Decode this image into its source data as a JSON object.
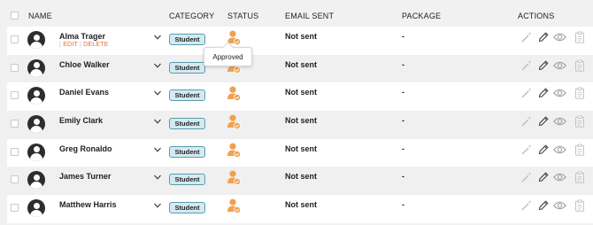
{
  "header": {
    "name": "NAME",
    "category": "CATEGORY",
    "status": "STATUS",
    "email_sent": "EMAIL SENT",
    "package": "PACKAGE",
    "actions": "ACTIONS"
  },
  "row_actions": {
    "edit": "EDIT",
    "delete": "DELETE",
    "separator": "|"
  },
  "tooltip": "Approved",
  "rows": [
    {
      "name": "Alma Trager",
      "category": "Student",
      "email_sent": "Not sent",
      "package": "-"
    },
    {
      "name": "Chloe Walker",
      "category": "Student",
      "email_sent": "Not sent",
      "package": "-"
    },
    {
      "name": "Daniel Evans",
      "category": "Student",
      "email_sent": "Not sent",
      "package": "-"
    },
    {
      "name": "Emily Clark",
      "category": "Student",
      "email_sent": "Not sent",
      "package": "-"
    },
    {
      "name": "Greg Ronaldo",
      "category": "Student",
      "email_sent": "Not sent",
      "package": "-"
    },
    {
      "name": "James Turner",
      "category": "Student",
      "email_sent": "Not sent",
      "package": "-"
    },
    {
      "name": "Matthew Harris",
      "category": "Student",
      "email_sent": "Not sent",
      "package": "-"
    }
  ],
  "icons": {
    "avatar": "user-avatar-icon",
    "expand": "chevron-down-icon",
    "status": "user-approved-icon",
    "actions": [
      "magic-wand-icon",
      "pencil-icon",
      "eye-icon",
      "clipboard-icon"
    ]
  },
  "colors": {
    "accent": "#f0a050",
    "delete_link": "#e06a3a",
    "badge_bg": "#d4eaf1",
    "badge_border": "#5a9bb0"
  }
}
